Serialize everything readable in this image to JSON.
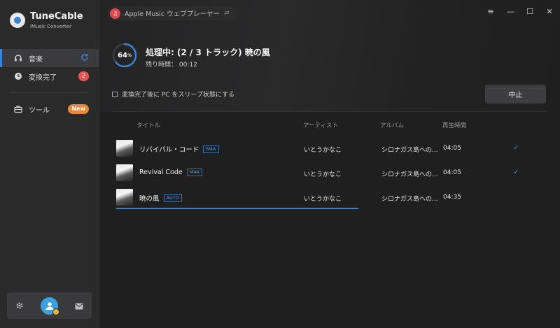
{
  "app": {
    "name": "TuneCable",
    "subtitle": "iMusic Converter"
  },
  "sidebar": {
    "items": [
      {
        "label": "音楽",
        "icon": "headphones-icon",
        "active": true
      },
      {
        "label": "変換完了",
        "icon": "clock-icon",
        "badge": "2"
      },
      {
        "label": "ツール",
        "icon": "toolbox-icon",
        "badge": "New"
      }
    ]
  },
  "source": {
    "label": "Apple Music ウェブプレーヤー",
    "icon": "music-note-icon"
  },
  "window_controls": {
    "menu": "≡",
    "minimize": "—",
    "maximize": "☐",
    "close": "✕"
  },
  "conversion": {
    "percent": "64",
    "percent_sign": "%",
    "progress_fraction": 0.64,
    "title": "処理中: (2 / 3 トラック) 暁の風",
    "remaining": "残り時間： 00:12",
    "sleep_option": "変換完了後に PC をスリープ状態にする",
    "stop_label": "中止"
  },
  "table": {
    "headers": [
      "タイトル",
      "アーティスト",
      "アルバム",
      "再生時間"
    ],
    "rows": [
      {
        "title": "リバイバル・コード",
        "format": "M4A",
        "artist": "いとうかなこ",
        "album": "シロナガス島への...",
        "duration": "04:05",
        "done": true
      },
      {
        "title": "Revival Code",
        "format": "M4A",
        "artist": "いとうかなこ",
        "album": "シロナガス島への...",
        "duration": "04:05",
        "done": true
      },
      {
        "title": "暁の風",
        "format": "AUTO",
        "artist": "いとうかなこ",
        "album": "シロナガス島への...",
        "duration": "04:35",
        "done": false
      }
    ]
  },
  "colors": {
    "accent": "#3a83d6",
    "badge_red": "#e45454",
    "badge_new": "#e4893b"
  }
}
